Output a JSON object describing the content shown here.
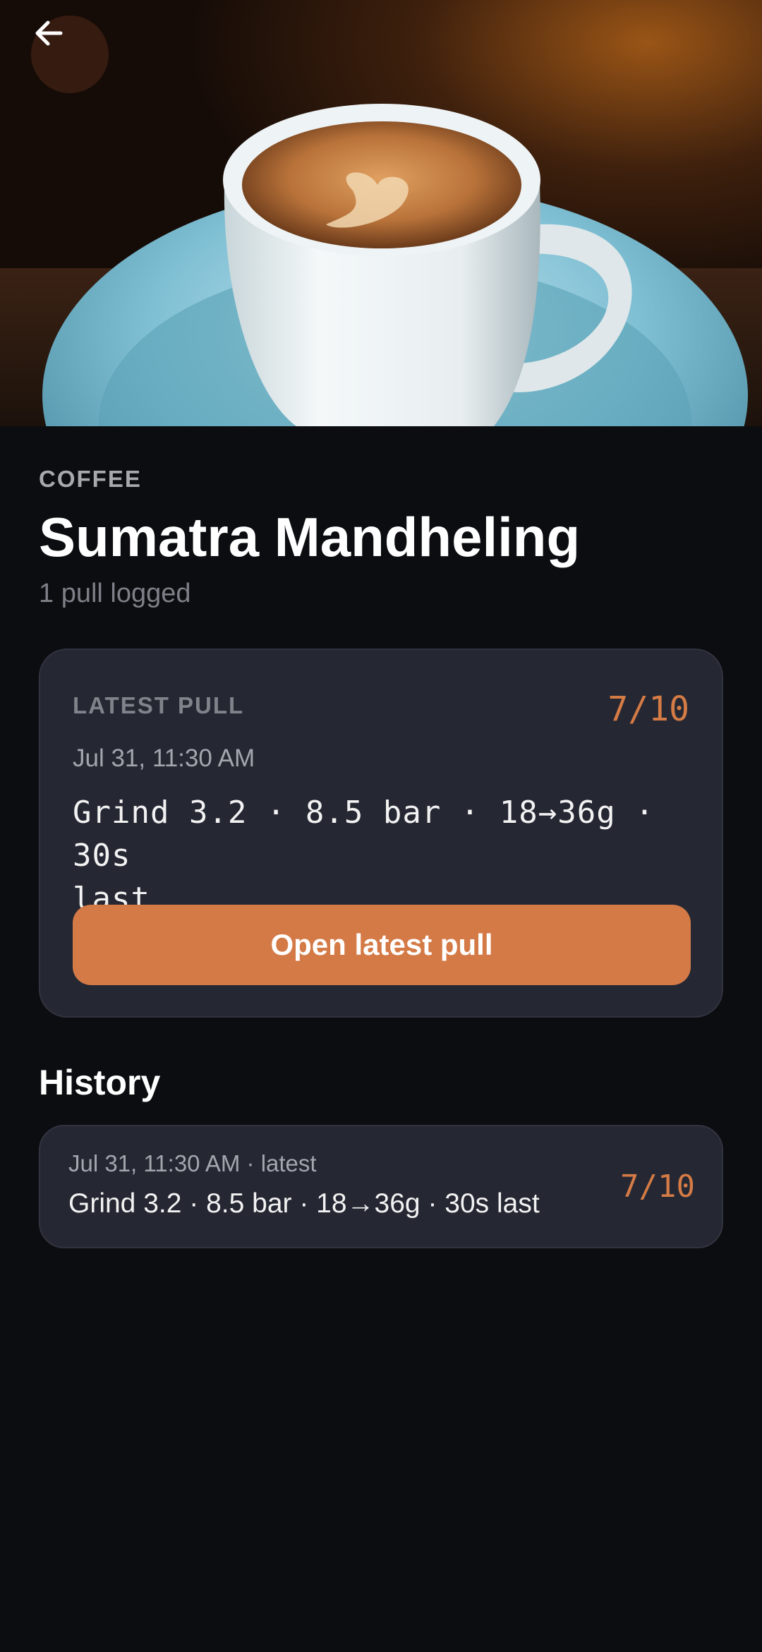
{
  "hero": {
    "image_subject": "latte-art-cup-on-blue-saucer",
    "back_icon": "arrow-left-icon"
  },
  "header": {
    "category": "COFFEE",
    "title": "Sumatra Mandheling",
    "subtitle": "1 pull logged"
  },
  "latest_pull": {
    "label": "LATEST PULL",
    "score": "7/10",
    "date": "Jul 31, 11:30 AM",
    "details_line1": "Grind 3.2 · 8.5 bar · 18→36g · 30s",
    "details_line2": "last",
    "button_label": "Open latest pull"
  },
  "history": {
    "title": "History",
    "items": [
      {
        "meta": "Jul 31, 11:30 AM · latest",
        "details": "Grind 3.2 · 8.5 bar · 18→36g · 30s last",
        "score": "7/10"
      }
    ]
  },
  "colors": {
    "background": "#0b0d11",
    "card": "#252833",
    "accent": "#d47a46",
    "score": "#d57b45"
  }
}
